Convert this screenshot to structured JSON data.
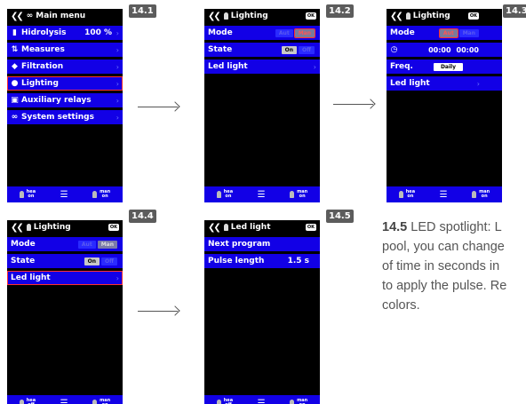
{
  "screen1": {
    "badge": "14.1",
    "title": "Main menu",
    "items": [
      {
        "label": "Hidrolysis",
        "value": "100 %",
        "icon": "▮"
      },
      {
        "label": "Measures",
        "icon": "⇅"
      },
      {
        "label": "Filtration",
        "icon": "◆"
      },
      {
        "label": "Lighting",
        "icon": "●"
      },
      {
        "label": "Auxiliary relays",
        "icon": "▣"
      },
      {
        "label": "System settings",
        "icon": "∞"
      }
    ]
  },
  "screen2": {
    "badge": "14.2",
    "title": "Lighting",
    "ok": "OK",
    "mode_label": "Mode",
    "mode_options": [
      "Aut",
      "Man"
    ],
    "state_label": "State",
    "state_options": [
      "On",
      "Off"
    ],
    "led_label": "Led light"
  },
  "screen3": {
    "badge": "14.3",
    "title": "Lighting",
    "ok": "OK",
    "mode_label": "Mode",
    "mode_options": [
      "Aut",
      "Man"
    ],
    "time_start": "00:00",
    "time_end": "00:00",
    "freq_label": "Freq.",
    "freq_value": "Daily",
    "led_label": "Led light"
  },
  "screen4": {
    "badge": "14.4",
    "title": "Lighting",
    "ok": "OK",
    "mode_label": "Mode",
    "mode_options": [
      "Aut",
      "Man"
    ],
    "state_label": "State",
    "state_options": [
      "On",
      "Off"
    ],
    "led_label": "Led light"
  },
  "screen5": {
    "badge": "14.5",
    "title": "Led light",
    "ok": "OK",
    "next_label": "Next program",
    "pulse_label": "Pulse length",
    "pulse_value": "1.5 s"
  },
  "footer": {
    "hea_top": "hea",
    "hea_on": "on",
    "hea_off": "off",
    "man_top": "man",
    "man_on": "on"
  },
  "description": {
    "number": "14.5",
    "heading": "LED spotlight:",
    "line1_rest": " L",
    "line2": "pool, you can change",
    "line3": "of time in seconds in",
    "line4": "to apply the pulse. Re",
    "line5": "colors."
  }
}
